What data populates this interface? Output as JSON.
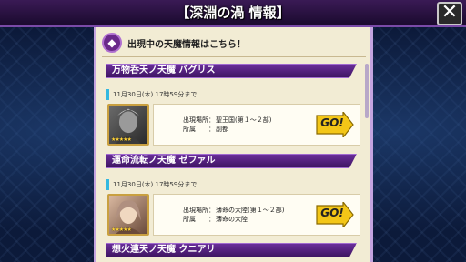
{
  "header": {
    "title": "【深淵の渦 情報】",
    "close_label": "✕"
  },
  "info": {
    "icon": "emblem-icon",
    "text": "出現中の天魔情報はこちら！"
  },
  "cards": [
    {
      "name": "万物呑天ノ天魔 バグリス",
      "date": "11月30日(木) 17時59分まで",
      "location_label": "出現場所：",
      "location": "聖王国(第１～２部)",
      "affiliation_label": "所属　　：",
      "affiliation": "副都",
      "go_label": "GO!",
      "stars": "★★★★★"
    },
    {
      "name": "運命流転ノ天魔 ゼファル",
      "date": "11月30日(木) 17時59分まで",
      "location_label": "出現場所：",
      "location": "薄命の大陸(第１～２部)",
      "affiliation_label": "所属　　：",
      "affiliation": "薄命の大陸",
      "go_label": "GO!",
      "stars": "★★★★★"
    }
  ],
  "next_card": {
    "name": "想火連天ノ天魔 クニアリ"
  },
  "colors": {
    "accent": "#6a2e9a",
    "panel": "#f2ecd4",
    "go": "#f3c617",
    "date_mark": "#33b8e0"
  }
}
